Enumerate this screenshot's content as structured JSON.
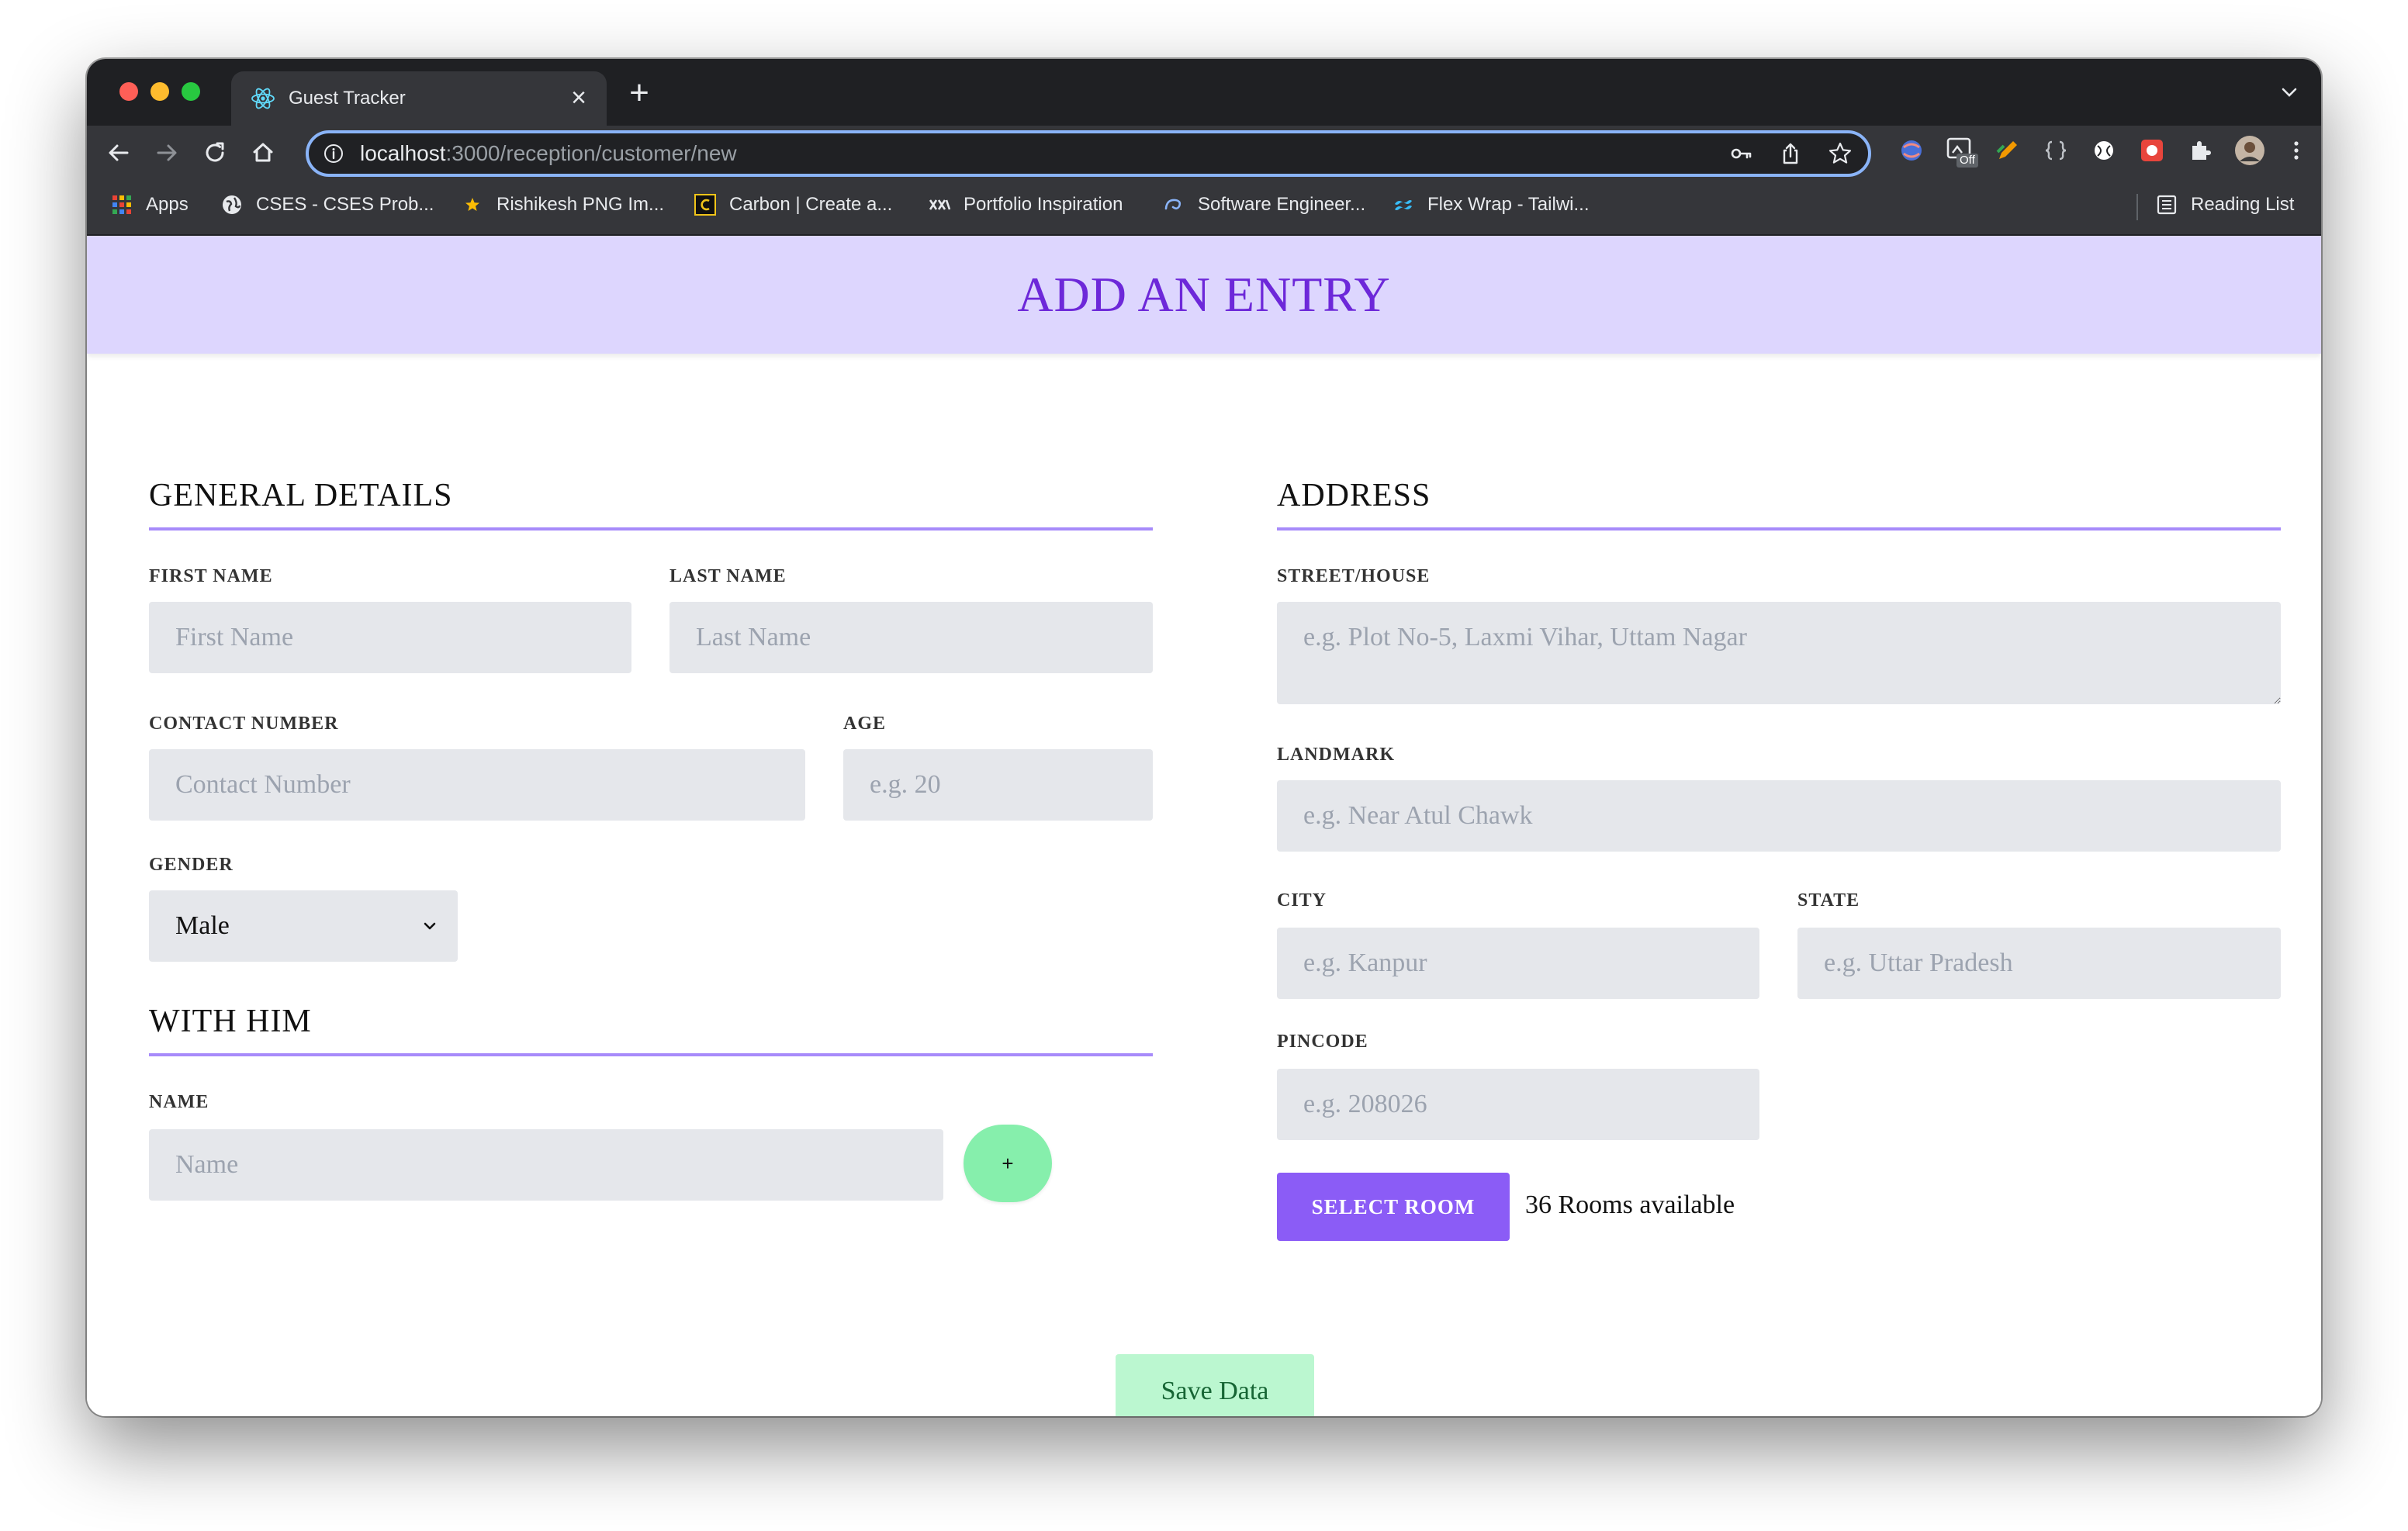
{
  "browser": {
    "tab_title": "Guest Tracker",
    "new_tab_glyph": "+",
    "close_glyph": "×",
    "url_host": "localhost",
    "url_path": ":3000/reception/customer/new",
    "bookmarks": [
      {
        "label": "Apps",
        "icon": "apps-grid-icon"
      },
      {
        "label": "CSES - CSES Prob...",
        "icon": "globe-icon"
      },
      {
        "label": "Rishikesh PNG Im...",
        "icon": "star-icon"
      },
      {
        "label": "Carbon | Create a...",
        "icon": "carbon-icon"
      },
      {
        "label": "Portfolio Inspiration",
        "icon": "portfolio-icon"
      },
      {
        "label": "Software Engineer...",
        "icon": "swirl-icon"
      },
      {
        "label": "Flex Wrap - Tailwi...",
        "icon": "tailwind-icon"
      }
    ],
    "reading_list": "Reading List",
    "ext_badge": "Off"
  },
  "page": {
    "title": "ADD AN ENTRY"
  },
  "general": {
    "heading": "GENERAL DETAILS",
    "first_name_label": "FIRST NAME",
    "first_name_placeholder": "First Name",
    "last_name_label": "LAST NAME",
    "last_name_placeholder": "Last Name",
    "contact_label": "CONTACT NUMBER",
    "contact_placeholder": "Contact Number",
    "age_label": "AGE",
    "age_placeholder": "e.g. 20",
    "gender_label": "GENDER",
    "gender_value": "Male"
  },
  "with_him": {
    "heading": "WITH HIM",
    "name_label": "NAME",
    "name_placeholder": "Name",
    "add_label": "+"
  },
  "address": {
    "heading": "ADDRESS",
    "street_label": "STREET/HOUSE",
    "street_placeholder": "e.g. Plot No-5, Laxmi Vihar, Uttam Nagar",
    "landmark_label": "LANDMARK",
    "landmark_placeholder": "e.g. Near Atul Chawk",
    "city_label": "CITY",
    "city_placeholder": "e.g. Kanpur",
    "state_label": "STATE",
    "state_placeholder": "e.g. Uttar Pradesh",
    "pincode_label": "PINCODE",
    "pincode_placeholder": "e.g. 208026",
    "select_room_label": "SELECT ROOM",
    "rooms_available": "36 Rooms available"
  },
  "actions": {
    "save_label": "Save Data"
  },
  "colors": {
    "header_bg": "#ddd6fe",
    "title_color": "#6d28d9",
    "accent": "#8b5cf6",
    "rule": "#a78bfa",
    "add_button": "#86efac",
    "save_button": "#bbf7d0",
    "field_bg": "#e5e7eb"
  }
}
